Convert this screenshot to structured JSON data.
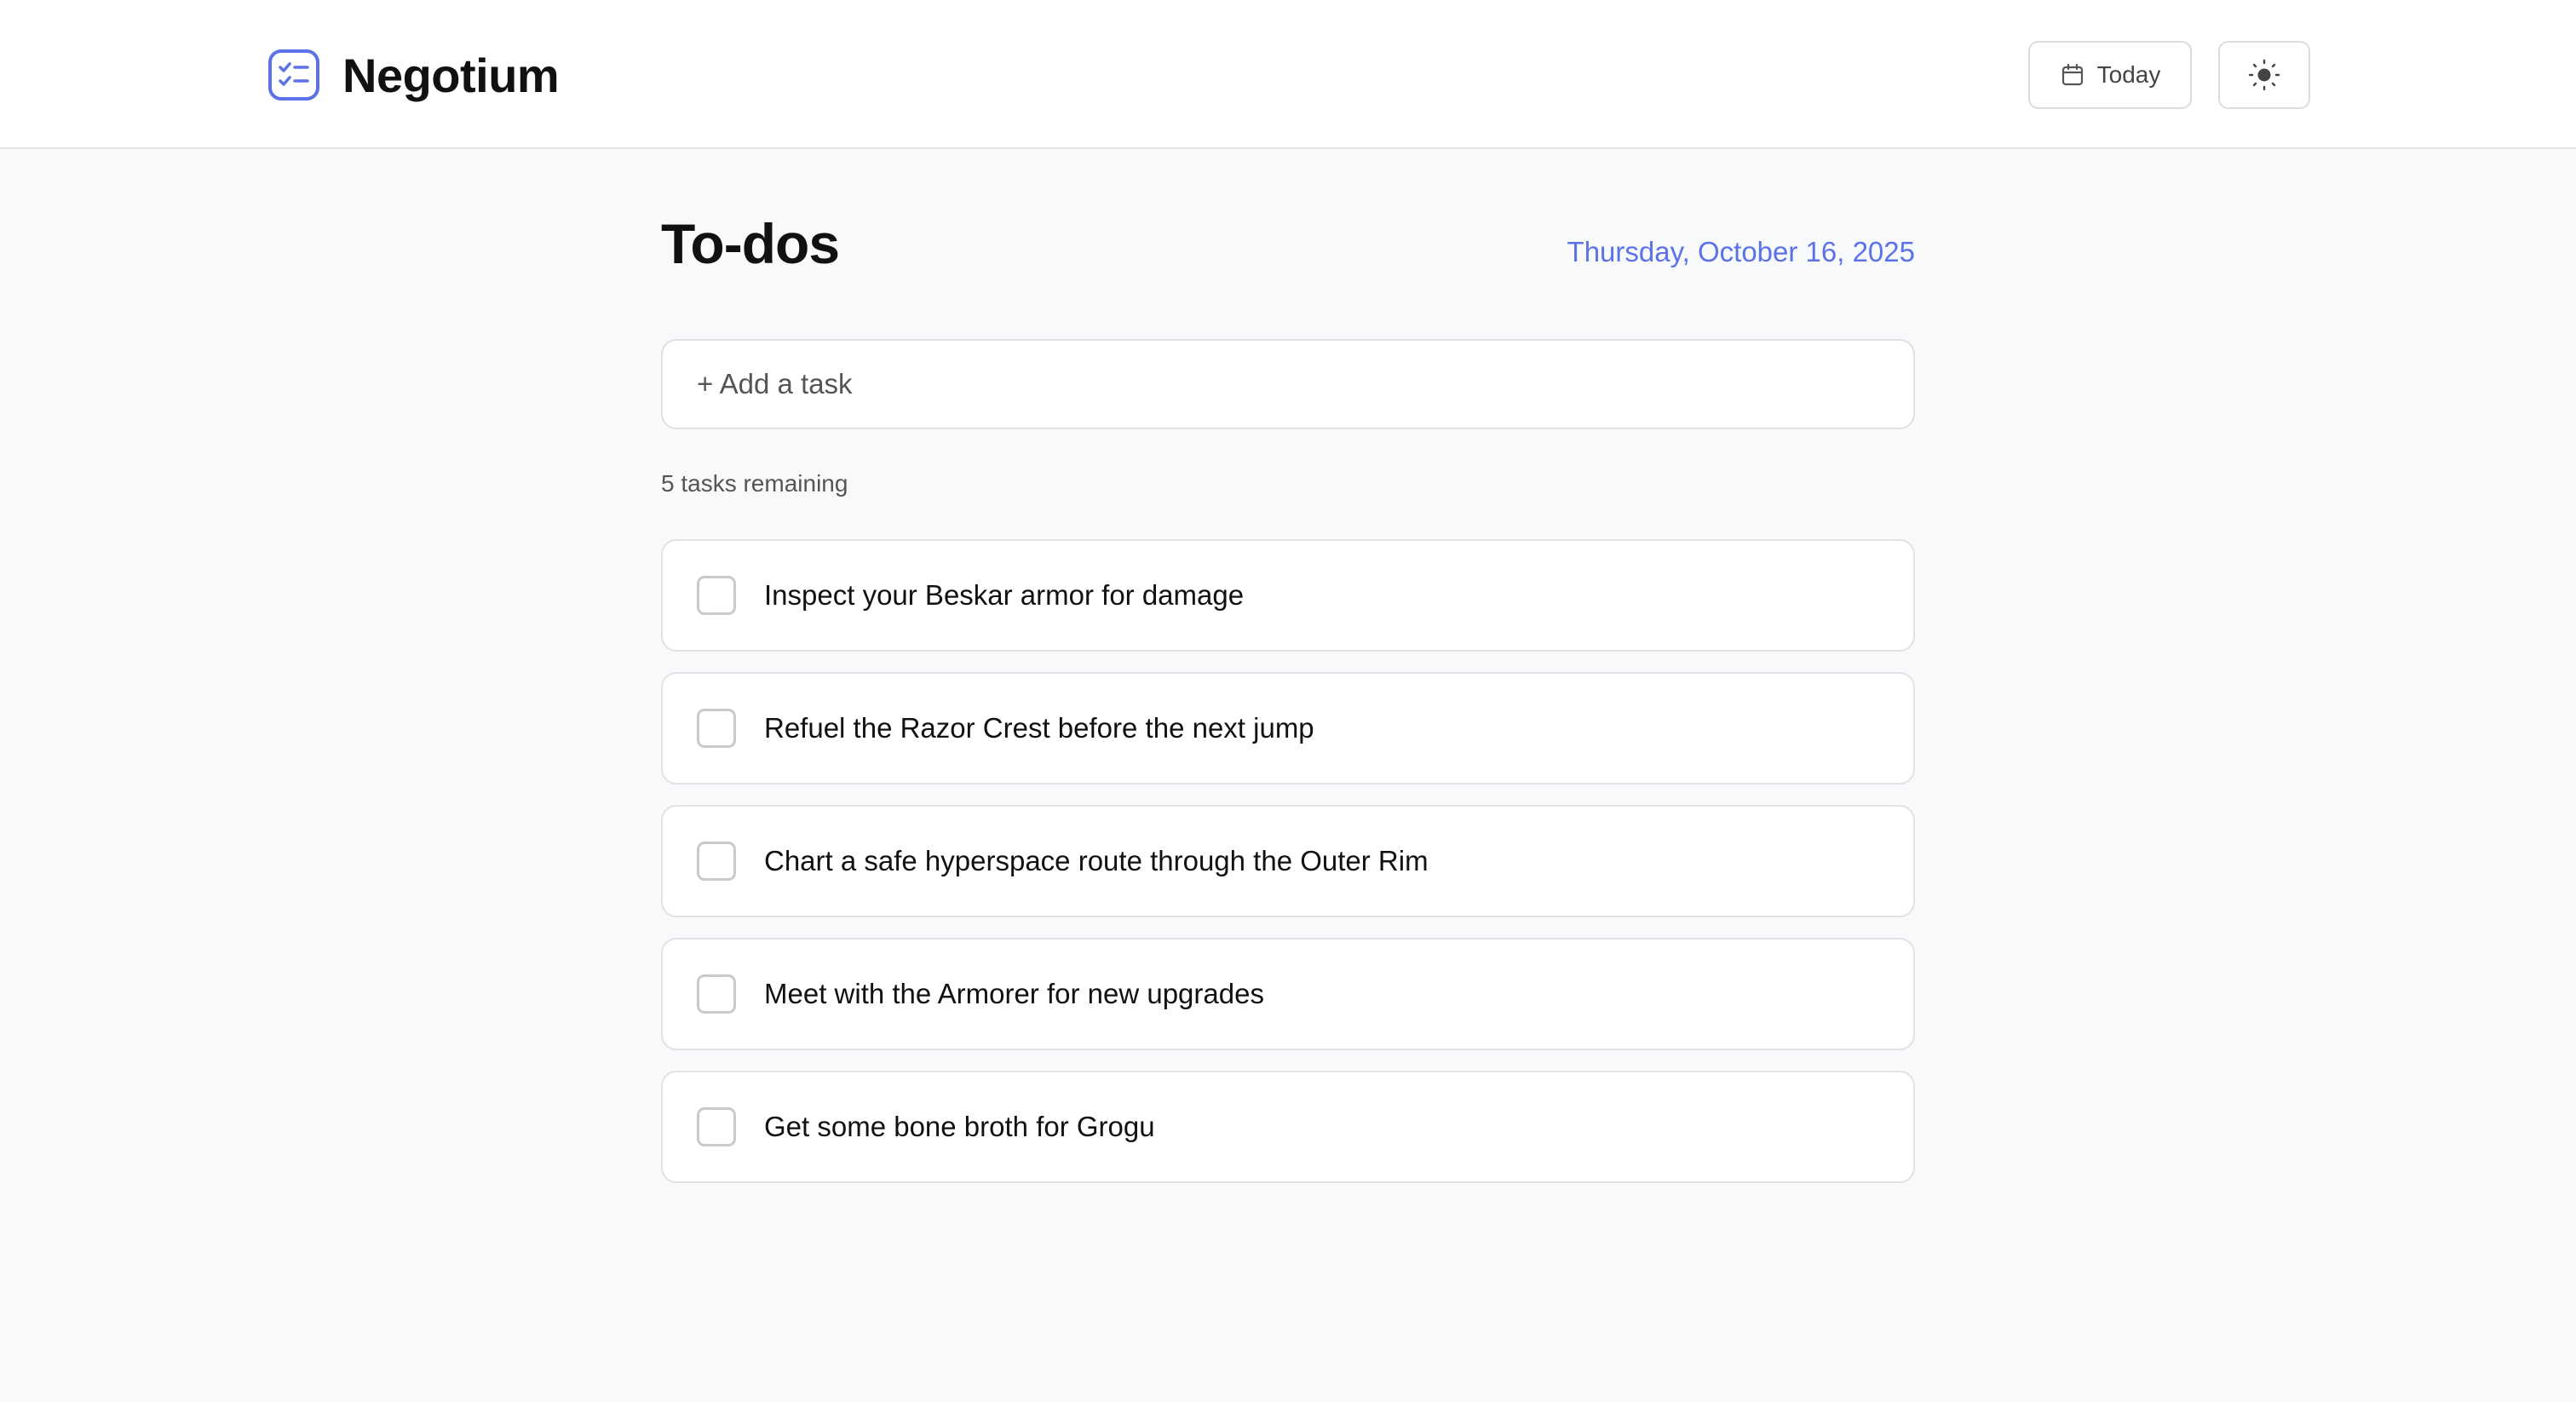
{
  "header": {
    "app_name": "Negotium",
    "logo_icon": "checklist-icon",
    "today_label": "Today",
    "today_icon": "calendar-icon",
    "theme_icon": "sun-icon"
  },
  "main": {
    "title": "To-dos",
    "date": "Thursday, October 16, 2025",
    "add_placeholder": "+ Add a task",
    "remaining": "5 tasks remaining",
    "tasks": [
      {
        "text": "Inspect your Beskar armor for damage",
        "done": false
      },
      {
        "text": "Refuel the Razor Crest before the next jump",
        "done": false
      },
      {
        "text": "Chart a safe hyperspace route through the Outer Rim",
        "done": false
      },
      {
        "text": "Meet with the Armorer for new upgrades",
        "done": false
      },
      {
        "text": "Get some bone broth for Grogu",
        "done": false
      }
    ]
  },
  "colors": {
    "accent": "#5b72e8",
    "background": "#f8f9fa",
    "card": "#ffffff",
    "border": "#e2e2e6"
  }
}
